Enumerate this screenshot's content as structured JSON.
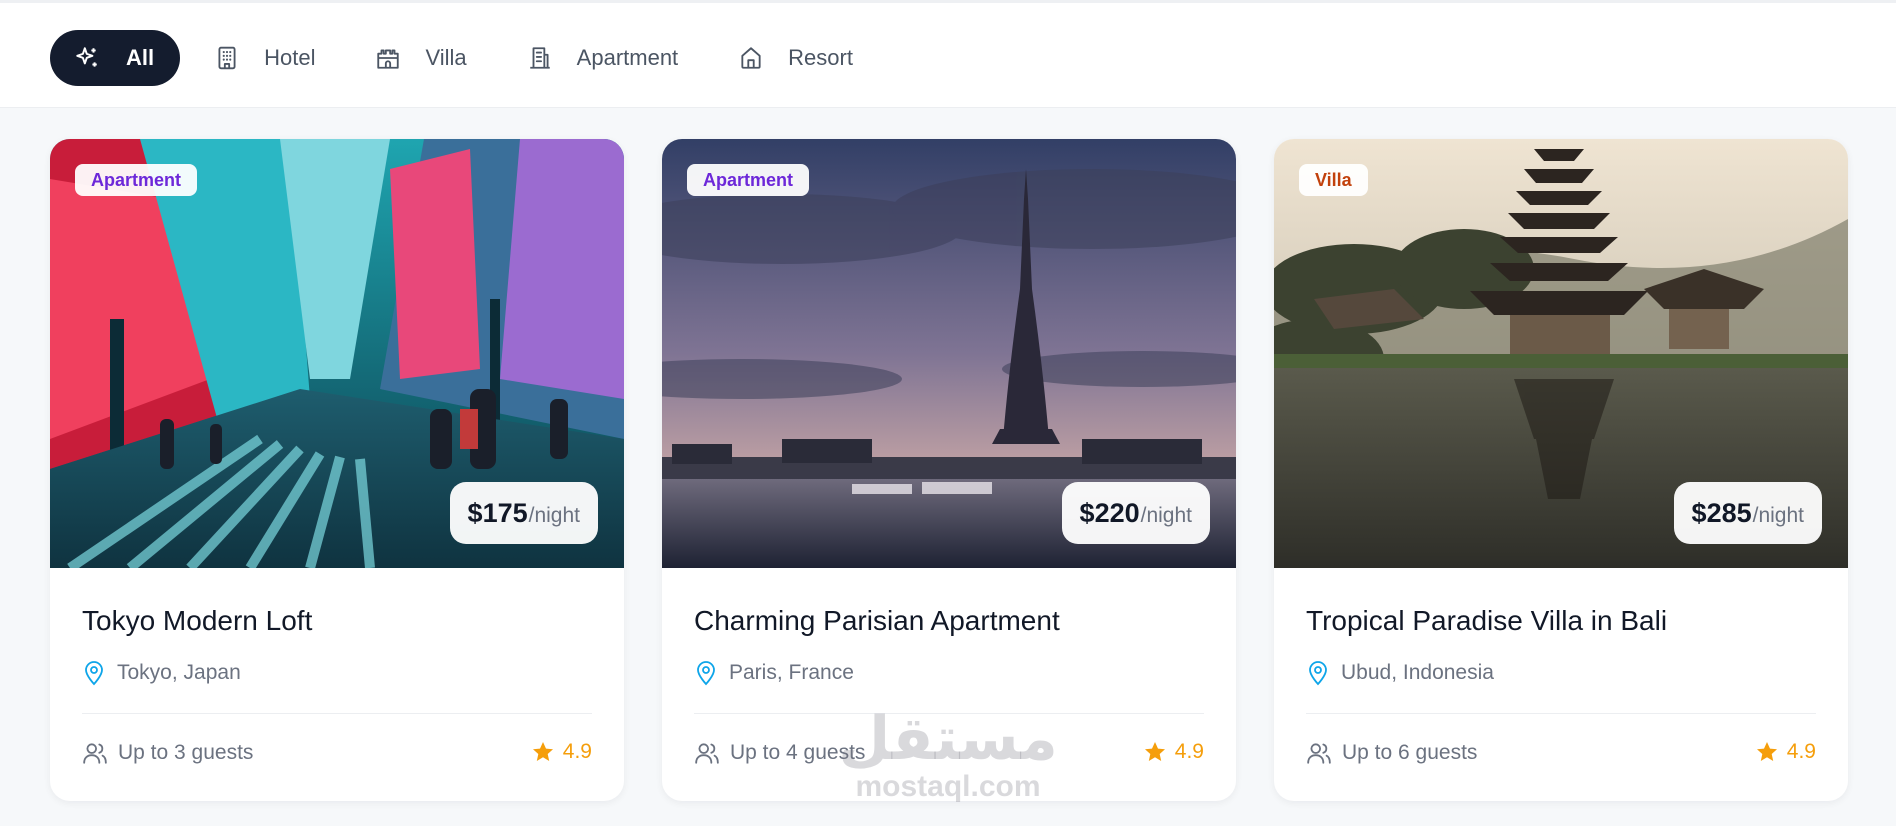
{
  "filters": [
    {
      "label": "All",
      "icon": "sparkles-icon",
      "active": true
    },
    {
      "label": "Hotel",
      "icon": "building-icon",
      "active": false
    },
    {
      "label": "Villa",
      "icon": "castle-icon",
      "active": false
    },
    {
      "label": "Apartment",
      "icon": "apartment-building-icon",
      "active": false
    },
    {
      "label": "Resort",
      "icon": "home-icon",
      "active": false
    }
  ],
  "listings": [
    {
      "type": "Apartment",
      "type_color": "#6d28d9",
      "price": "$175",
      "price_unit": "/night",
      "title": "Tokyo Modern Loft",
      "location": "Tokyo, Japan",
      "guests": "Up to 3 guests",
      "rating": "4.9",
      "image": "tokyo-street-photo"
    },
    {
      "type": "Apartment",
      "type_color": "#6d28d9",
      "price": "$220",
      "price_unit": "/night",
      "title": "Charming Parisian Apartment",
      "location": "Paris, France",
      "guests": "Up to 4 guests",
      "rating": "4.9",
      "image": "eiffel-tower-photo"
    },
    {
      "type": "Villa",
      "type_color": "#c2410c",
      "price": "$285",
      "price_unit": "/night",
      "title": "Tropical Paradise Villa in Bali",
      "location": "Ubud, Indonesia",
      "guests": "Up to 6 guests",
      "rating": "4.9",
      "image": "bali-temple-photo"
    }
  ],
  "watermark": {
    "arabic": "مستقل",
    "latin": "mostaql.com"
  },
  "colors": {
    "active_filter_bg": "#141c2e",
    "star": "#f59e0b",
    "location_pin": "#0ea5e9"
  }
}
